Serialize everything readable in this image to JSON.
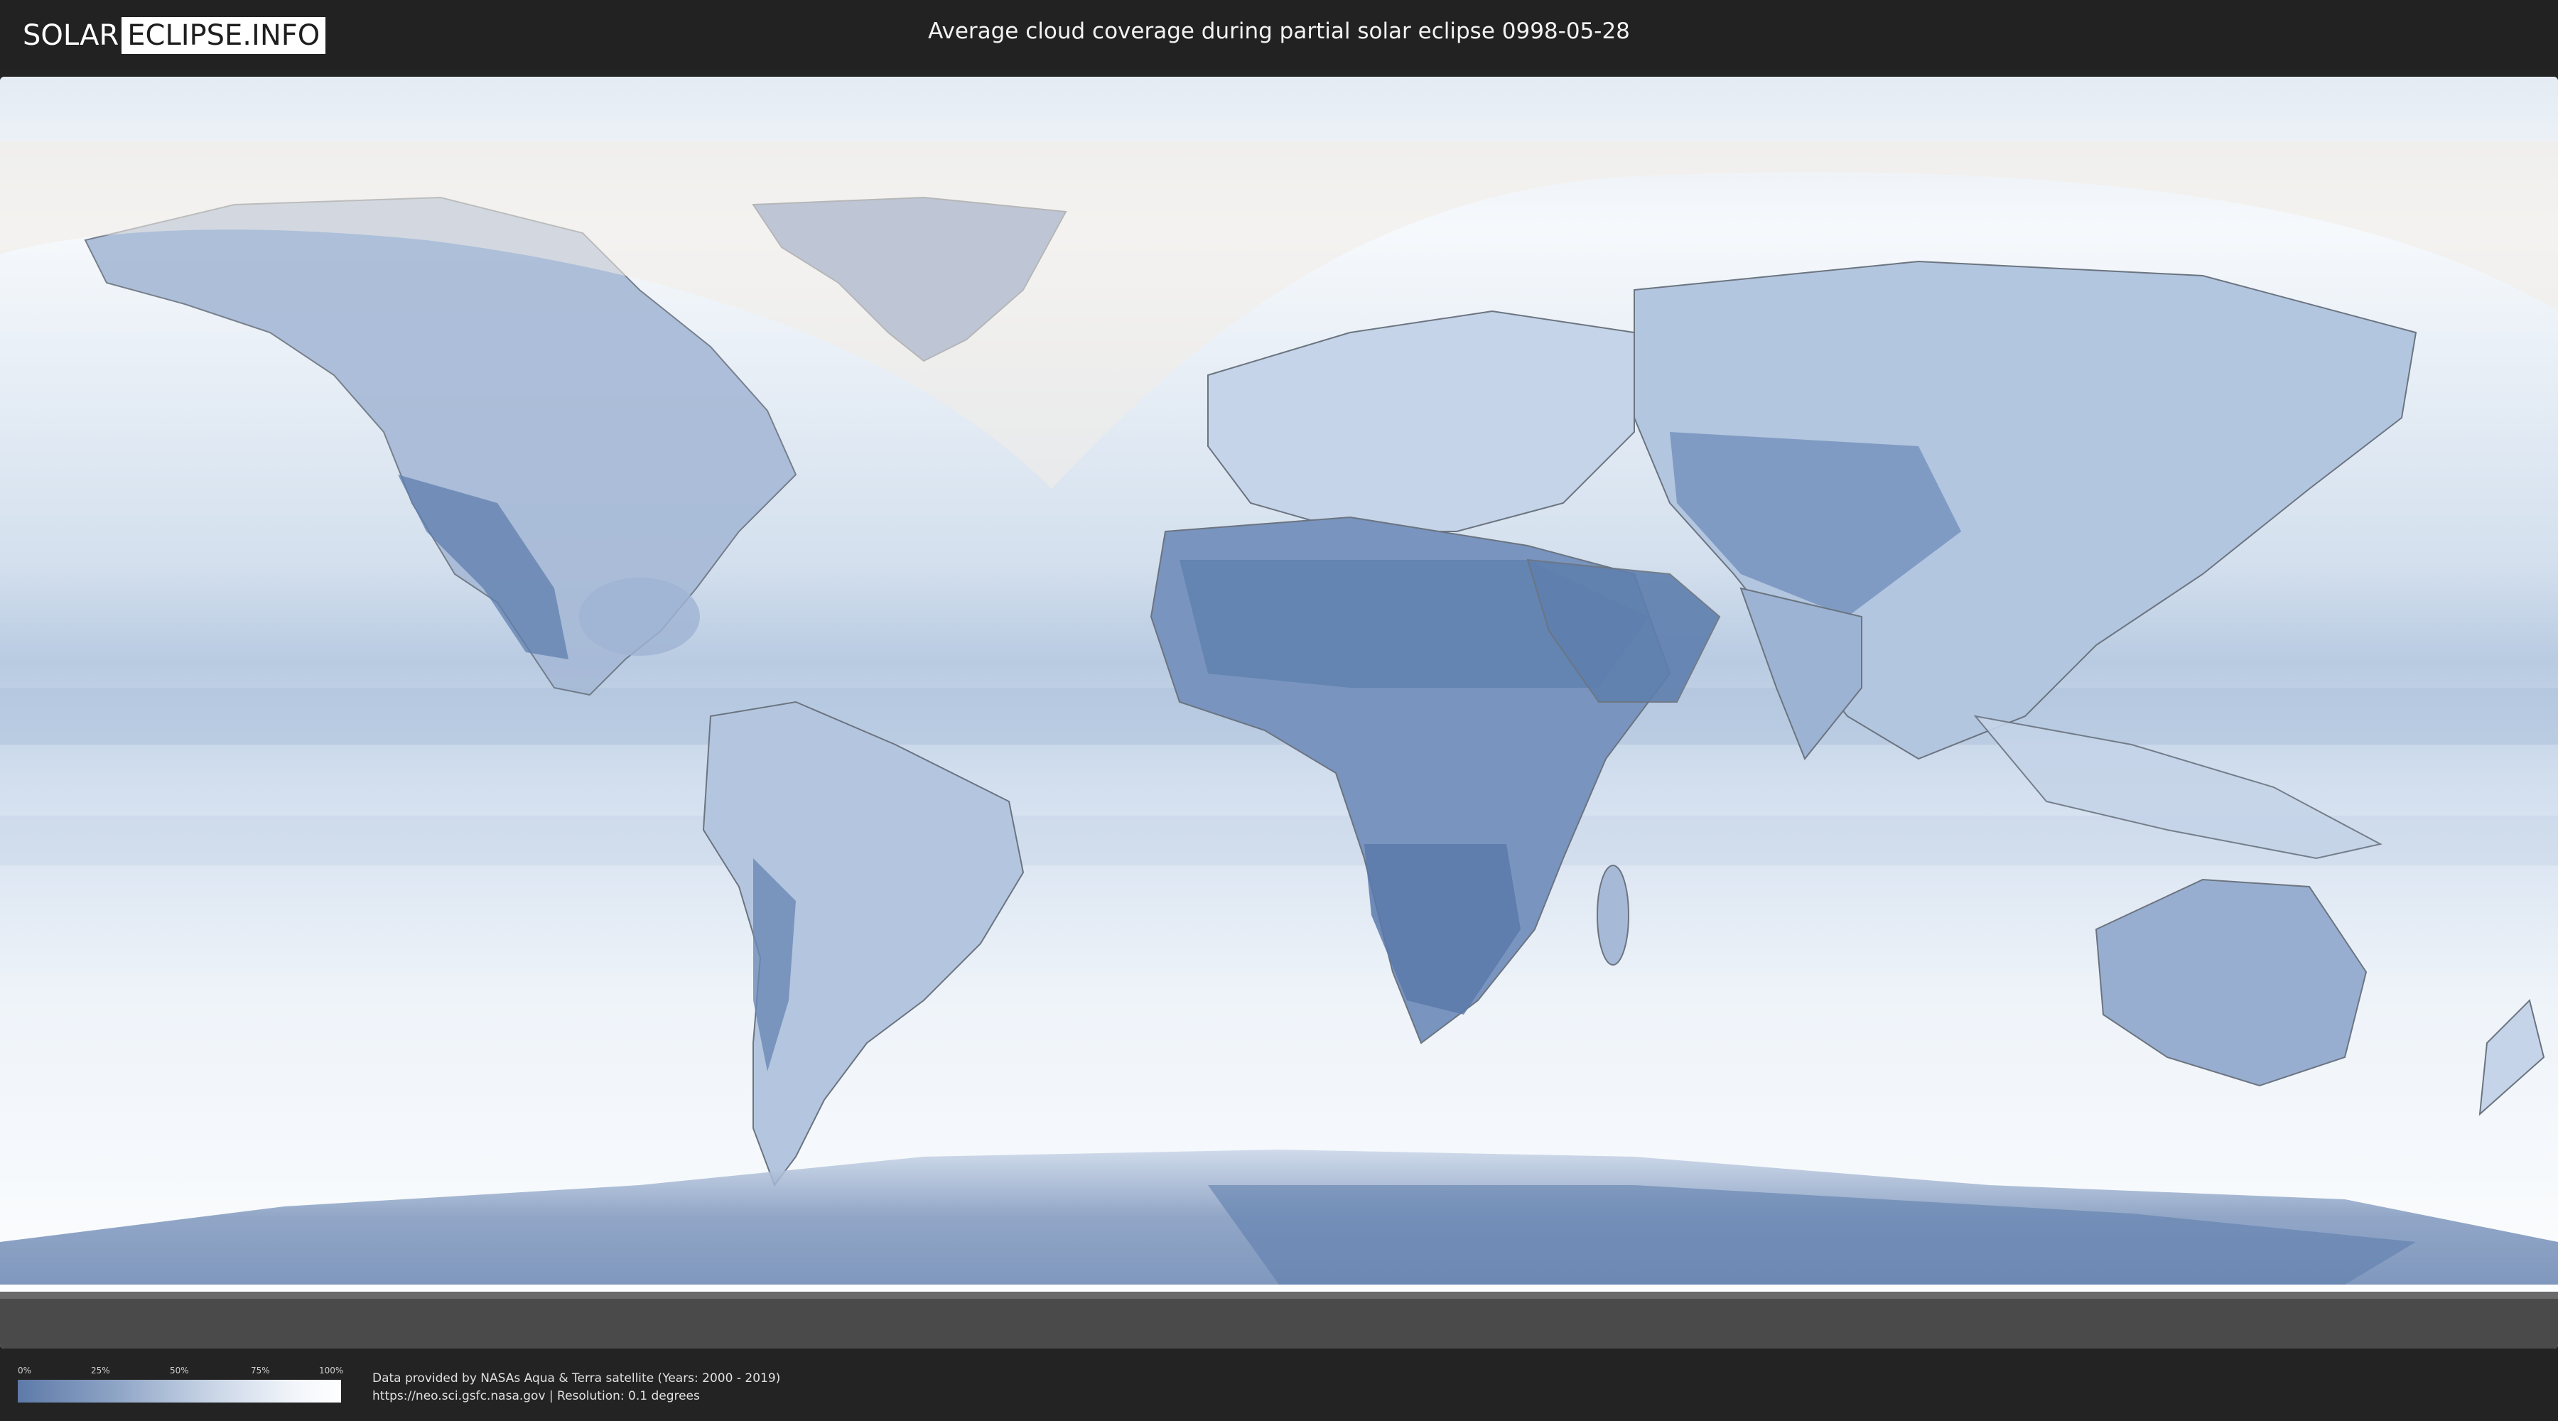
{
  "header": {
    "logo": {
      "left": "SOLAR",
      "right": "ECLIPSE.INFO"
    },
    "title": "Average cloud coverage during partial solar eclipse 0998-05-28"
  },
  "map": {
    "icon": "world-cloud-map",
    "colors": {
      "ocean_cloud": "#eef3f9",
      "clear_sky": "#5f7fae",
      "land_border": "#6b7480",
      "eclipse_shadow": "#f3ede6",
      "ice_bottom": "#4a4a4a"
    }
  },
  "legend": {
    "ticks": [
      "0%",
      "25%",
      "50%",
      "75%",
      "100%"
    ],
    "gradient_start": "#5d7aa8",
    "gradient_end": "#ffffff"
  },
  "footer": {
    "line1": "Data provided by NASAs Aqua & Terra satellite (Years: 2000 - 2019)",
    "line2": "https://neo.sci.gsfc.nasa.gov | Resolution: 0.1 degrees"
  }
}
